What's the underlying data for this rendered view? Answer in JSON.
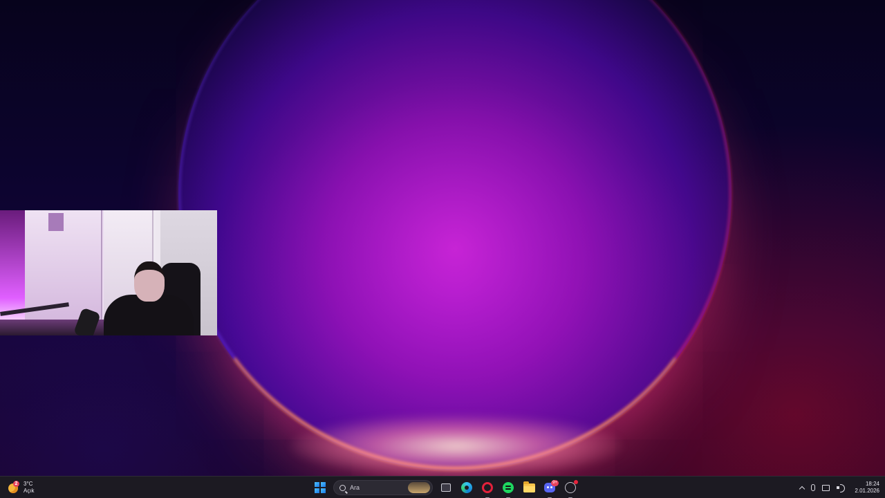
{
  "weather": {
    "badge": "2",
    "temperature": "3°C",
    "condition": "Açık"
  },
  "taskbar": {
    "search_placeholder": "Ara",
    "apps": [
      {
        "name": "start",
        "icon": "windows-logo-icon"
      },
      {
        "name": "task-view",
        "icon": "task-view-icon"
      },
      {
        "name": "edge",
        "icon": "edge-icon"
      },
      {
        "name": "opera-gx",
        "icon": "opera-icon",
        "active": true
      },
      {
        "name": "spotify",
        "icon": "spotify-icon",
        "active": true
      },
      {
        "name": "file-explorer",
        "icon": "folder-icon"
      },
      {
        "name": "discord",
        "icon": "discord-icon",
        "badge": "9+",
        "active": true
      },
      {
        "name": "steam",
        "icon": "steam-icon",
        "active": true
      }
    ],
    "discord_badge": "9+"
  },
  "tray": {
    "time": "18:24",
    "date": "2.01.2026"
  },
  "colors": {
    "taskbar_bg": "#1c1a22",
    "accent_red": "#e8425a",
    "orb_magenta": "#c21fd8"
  }
}
